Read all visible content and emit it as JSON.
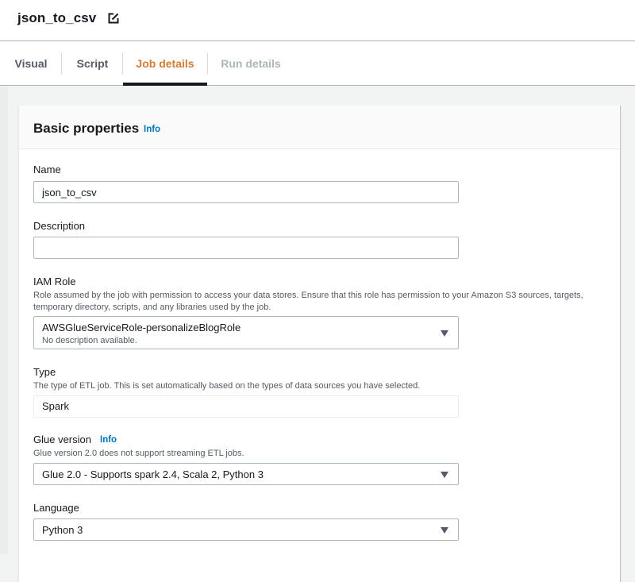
{
  "header": {
    "job_name": "json_to_csv",
    "edit_icon": "edit-icon"
  },
  "tabs": [
    {
      "label": "Visual",
      "state": "default"
    },
    {
      "label": "Script",
      "state": "default"
    },
    {
      "label": "Job details",
      "state": "active"
    },
    {
      "label": "Run details",
      "state": "disabled"
    }
  ],
  "colors": {
    "active_tab": "#d57b32",
    "link": "#0073bb",
    "text": "#16191f",
    "secondary_text": "#545b64"
  },
  "basic_properties": {
    "title": "Basic properties",
    "info_label": "Info",
    "name": {
      "label": "Name",
      "value": "json_to_csv"
    },
    "description": {
      "label": "Description",
      "value": ""
    },
    "iam_role": {
      "label": "IAM Role",
      "description": "Role assumed by the job with permission to access your data stores. Ensure that this role has permission to your Amazon S3 sources, targets, temporary directory, scripts, and any libraries used by the job.",
      "selected": "AWSGlueServiceRole-personalizeBlogRole",
      "selected_sub": "No description available."
    },
    "type": {
      "label": "Type",
      "description": "The type of ETL job. This is set automatically based on the types of data sources you have selected.",
      "value": "Spark"
    },
    "glue_version": {
      "label": "Glue version",
      "info_label": "Info",
      "description": "Glue version 2.0 does not support streaming ETL jobs.",
      "selected": "Glue 2.0 - Supports spark 2.4, Scala 2, Python 3"
    },
    "language": {
      "label": "Language",
      "selected": "Python 3"
    }
  }
}
